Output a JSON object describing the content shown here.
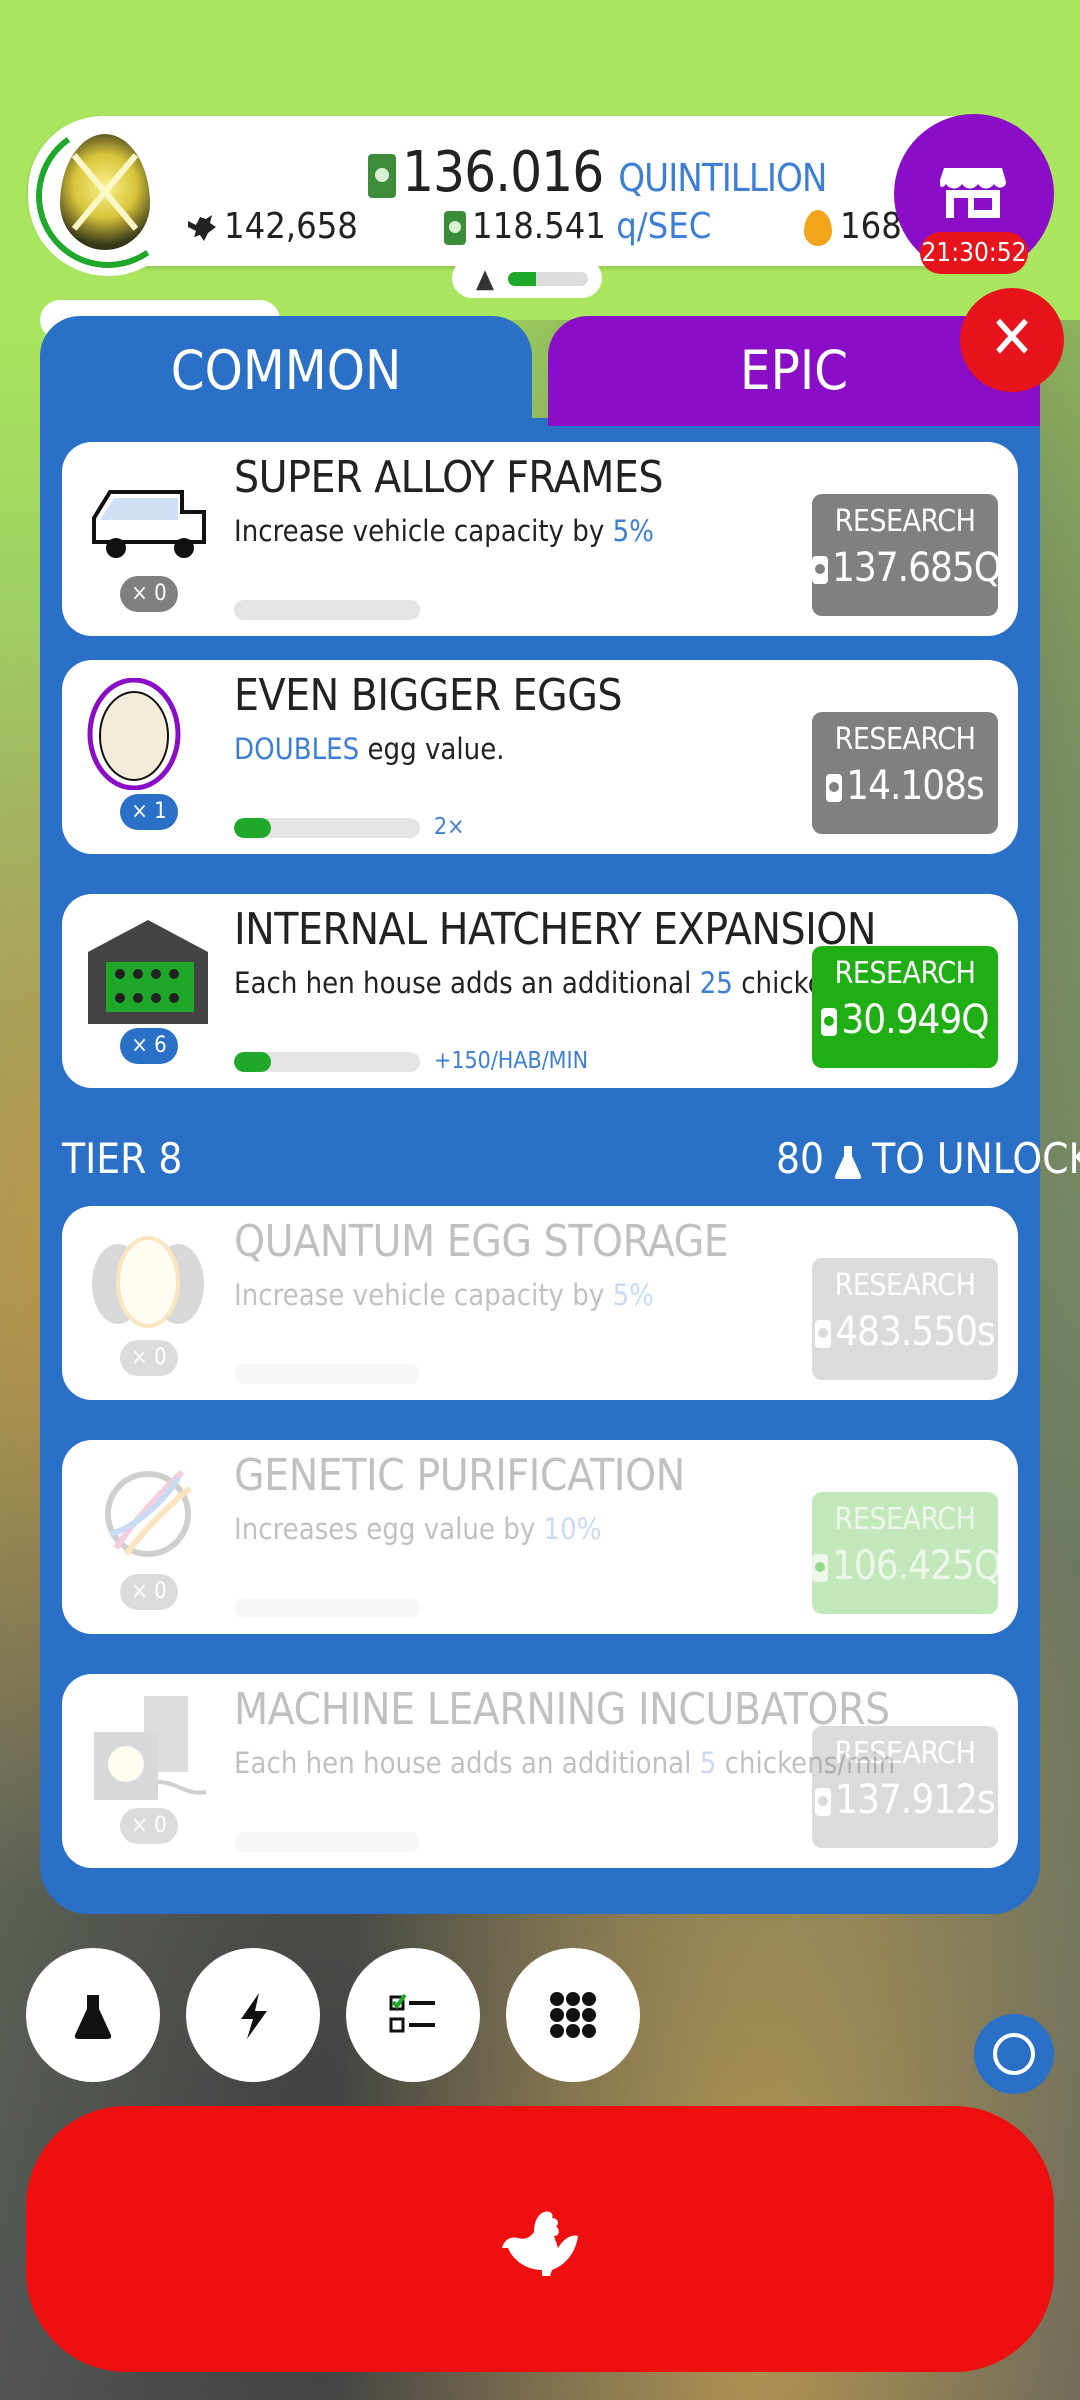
{
  "header": {
    "money_amount": "136.016",
    "money_unit": "QUINTILLION",
    "chicken_count": "142,658",
    "earning_rate": "118.541",
    "earning_unit": "q/SEC",
    "golden_eggs": "168",
    "shop_timer": "21:30:52",
    "chick_progress": 0.35
  },
  "tabs": [
    {
      "label": "COMMON",
      "active": true
    },
    {
      "label": "EPIC",
      "active": false
    }
  ],
  "research_items": [
    {
      "title": "SUPER ALLOY FRAMES",
      "desc_prefix": "Increase vehicle capacity by ",
      "desc_highlight": "5%",
      "desc_suffix": "",
      "count": "× 0",
      "button_label": "RESEARCH",
      "cost": "137.685Q",
      "bonus": "",
      "progress": 0,
      "state": "unaffordable"
    },
    {
      "title": "EVEN BIGGER EGGS",
      "desc_prefix": "",
      "desc_highlight": "DOUBLES",
      "desc_suffix": " egg value.",
      "count": "× 1",
      "button_label": "RESEARCH",
      "cost": "14.108s",
      "bonus": "2×",
      "progress": 0.2,
      "state": "unaffordable"
    },
    {
      "title": "INTERNAL HATCHERY EXPANSION",
      "desc_prefix": "Each hen house adds an additional ",
      "desc_highlight": "25",
      "desc_suffix": " chickens/min",
      "count": "× 6",
      "button_label": "RESEARCH",
      "cost": "30.949Q",
      "bonus": "+150/HAB/MIN",
      "progress": 0.2,
      "state": "affordable"
    }
  ],
  "tier": {
    "label": "TIER 8",
    "unlock_count": "80",
    "unlock_text": "TO UNLOCK"
  },
  "locked_items": [
    {
      "title": "QUANTUM EGG STORAGE",
      "desc_prefix": "Increase vehicle capacity by ",
      "desc_highlight": "5%",
      "desc_suffix": "",
      "count": "× 0",
      "button_label": "RESEARCH",
      "cost": "483.550s",
      "state": "locked"
    },
    {
      "title": "GENETIC PURIFICATION",
      "desc_prefix": "Increases egg value by ",
      "desc_highlight": "10%",
      "desc_suffix": "",
      "count": "× 0",
      "button_label": "RESEARCH",
      "cost": "106.425Q",
      "state": "locked-affordable"
    },
    {
      "title": "MACHINE LEARNING INCUBATORS",
      "desc_prefix": "Each hen house adds an additional ",
      "desc_highlight": "5",
      "desc_suffix": " chickens/min",
      "count": "× 0",
      "button_label": "RESEARCH",
      "cost": "137.912s",
      "state": "locked"
    }
  ],
  "colors": {
    "accent_blue": "#2a70c6",
    "epic_purple": "#8a0ec7",
    "research_green": "#1fae13",
    "alert_red": "#e8141b"
  },
  "bottom_icons": [
    "flask-icon",
    "lightning-icon",
    "checklist-icon",
    "grid-icon",
    "chicken-icon"
  ]
}
